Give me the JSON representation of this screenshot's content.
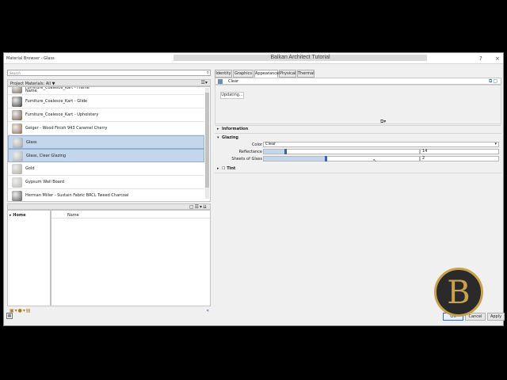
{
  "window": {
    "title": "Material Browser - Glass",
    "help_btn": "?",
    "close_btn": "×"
  },
  "watermark": "Balkan Architect Tutorial",
  "left": {
    "search_placeholder": "Search",
    "project_materials_label": "Project Materials: All",
    "materials_header": "Name",
    "materials": [
      {
        "name": "Furniture_Coalesce_Kart - Frame",
        "color": "#7a6a5a",
        "selected": false
      },
      {
        "name": "Furniture_Coalesce_Kart - Glide",
        "color": "#3a3a3a",
        "selected": false
      },
      {
        "name": "Furniture_Coalesce_Kart - Upholstery",
        "color": "#6b5a48",
        "selected": false
      },
      {
        "name": "Geiger - Wood Finish 943 Caramel Cherry",
        "color": "#8a6a4e",
        "selected": false
      },
      {
        "name": "Glass",
        "color": "#9a9ea2",
        "selected": true
      },
      {
        "name": "Glass, Clear Glazing",
        "color": "#a8acb0",
        "selected": true
      },
      {
        "name": "Gold",
        "color": "#b0a89a",
        "selected": false
      },
      {
        "name": "Gypsum Wall Board",
        "color": "#b8b8b6",
        "selected": false
      },
      {
        "name": "Herman Miller - Sustain Fabric BRCL Tweed Charcoal",
        "color": "#5a5a5a",
        "selected": false
      }
    ],
    "library_tree_home": "Home",
    "library_column": "Name"
  },
  "right": {
    "tabs": [
      {
        "label": "Identity",
        "active": false
      },
      {
        "label": "Graphics",
        "active": false
      },
      {
        "label": "Appearance",
        "active": true
      },
      {
        "label": "Physical",
        "active": false
      },
      {
        "label": "Thermal",
        "active": false
      }
    ],
    "asset_name": "Clear",
    "updating_label": "Updating...",
    "sections": {
      "information": "Information",
      "glazing": "Glazing",
      "tint": "Tint"
    },
    "glazing": {
      "color_label": "Color",
      "color_value": "Clear",
      "reflectance_label": "Reflectance",
      "reflectance_value": "14",
      "reflectance_fraction": 0.14,
      "sheets_label": "Sheets of Glass",
      "sheets_value": "2",
      "sheets_fraction": 0.4
    }
  },
  "buttons": {
    "ok": "OK",
    "cancel": "Cancel",
    "apply": "Apply"
  },
  "logo_letter": "B"
}
